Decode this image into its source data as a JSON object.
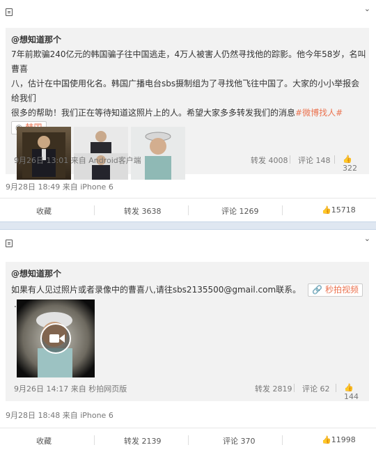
{
  "post1": {
    "author": "@想知道那个",
    "text_lines": [
      "7年前欺骗240亿元的韩国骗子往中国逃走，4万人被害人仍然寻找他的踪影。他今年58岁，名叫曹喜",
      "八，估计在中国使用化名。韩国广播电台sbs摄制组为了寻找他飞往中国了。大家的小小举报会给我们",
      "很多的帮助！我们正在等待知道这照片上的人。希望大家多多转发我们的消息"
    ],
    "hashtag": "#微博找人#",
    "location": "韩国",
    "date": "9月26日 13:01",
    "via": "来自 Android客户端",
    "repost": "转发 4008",
    "comment": "评论 148",
    "like": "322",
    "outer_date": "9月28日 18:49",
    "outer_via": "来自 iPhone 6",
    "actions": {
      "fav": "收藏",
      "repost": "转发 3638",
      "comment": "评论 1269",
      "like": "15718"
    }
  },
  "post2": {
    "author": "@想知道那个",
    "text": "如果有人见过照片或者录像中的曹喜八,请往sbs2135500@gmail.com联系。",
    "tag": "秒拍视频",
    "trail": ".",
    "date": "9月26日 14:17",
    "via": "来自 秒拍网页版",
    "repost": "转发 2819",
    "comment": "评论 62",
    "like": "144",
    "outer_date": "9月28日 18:48",
    "outer_via": "来自 iPhone 6",
    "actions": {
      "fav": "收藏",
      "repost": "转发 2139",
      "comment": "评论 370",
      "like": "11998"
    }
  },
  "icons": [
    "top-icon",
    "chevron-down-icon",
    "location-pin-icon",
    "thumbs-up-icon",
    "link-icon",
    "video-play-icon"
  ],
  "colors": {
    "link": "#eb7350",
    "inner_bg": "#f2f2f2",
    "divider": "#dfe7f1"
  }
}
